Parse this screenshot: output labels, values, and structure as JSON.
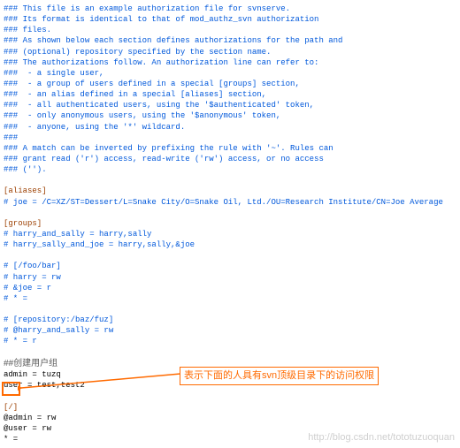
{
  "comments_top": [
    "### This file is an example authorization file for svnserve.",
    "### Its format is identical to that of mod_authz_svn authorization",
    "### files.",
    "### As shown below each section defines authorizations for the path and",
    "### (optional) repository specified by the section name.",
    "### The authorizations follow. An authorization line can refer to:",
    "###  - a single user,",
    "###  - a group of users defined in a special [groups] section,",
    "###  - an alias defined in a special [aliases] section,",
    "###  - all authenticated users, using the '$authenticated' token,",
    "###  - only anonymous users, using the '$anonymous' token,",
    "###  - anyone, using the '*' wildcard.",
    "###",
    "### A match can be inverted by prefixing the rule with '~'. Rules can",
    "### grant read ('r') access, read-write ('rw') access, or no access",
    "### ('')."
  ],
  "aliases_header": "[aliases]",
  "aliases_line": "# joe = /C=XZ/ST=Dessert/L=Snake City/O=Snake Oil, Ltd./OU=Research Institute/CN=Joe Average",
  "groups_header": "[groups]",
  "groups_lines": [
    "# harry_and_sally = harry,sally",
    "# harry_sally_and_joe = harry,sally,&joe"
  ],
  "foo_section": [
    "# [/foo/bar]",
    "# harry = rw",
    "# &joe = r",
    "# * ="
  ],
  "repo_section": [
    "# [repository:/baz/fuz]",
    "# @harry_and_sally = rw",
    "# * = r"
  ],
  "create_group_note": "##创建用户组",
  "create_group_lines": [
    "admin = tuzq",
    "user = test,test2"
  ],
  "root_section_header": "[/]",
  "root_section_lines": [
    "@admin = rw",
    "@user = rw",
    "* ="
  ],
  "callout_text": "表示下面的人具有svn顶级目录下的访问权限",
  "watermark": "http://blog.csdn.net/tototuzuoquan"
}
